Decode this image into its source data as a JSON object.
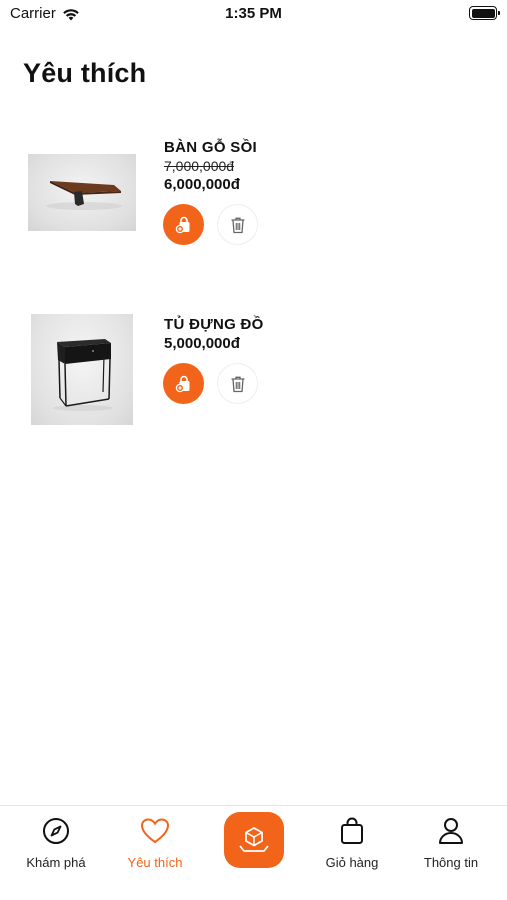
{
  "status_bar": {
    "carrier": "Carrier",
    "time": "1:35 PM"
  },
  "page": {
    "title": "Yêu thích"
  },
  "favorites": [
    {
      "name": "BÀN GỖ SỒI",
      "old_price": "7,000,000đ",
      "price": "6,000,000đ",
      "image_icon": "oak-table-image"
    },
    {
      "name": "TỦ ĐỰNG ĐỒ",
      "old_price": "",
      "price": "5,000,000đ",
      "image_icon": "storage-cabinet-image"
    }
  ],
  "tabbar": {
    "items": [
      {
        "label": "Khám phá",
        "icon": "compass-icon"
      },
      {
        "label": "Yêu thích",
        "icon": "heart-icon",
        "active": true
      },
      {
        "label": "",
        "icon": "ar-scan-icon"
      },
      {
        "label": "Giỏ hàng",
        "icon": "shopping-bag-icon"
      },
      {
        "label": "Thông tin",
        "icon": "user-icon"
      }
    ]
  },
  "colors": {
    "accent": "#f26419",
    "text": "#111111",
    "divider": "#e4e4e4"
  }
}
